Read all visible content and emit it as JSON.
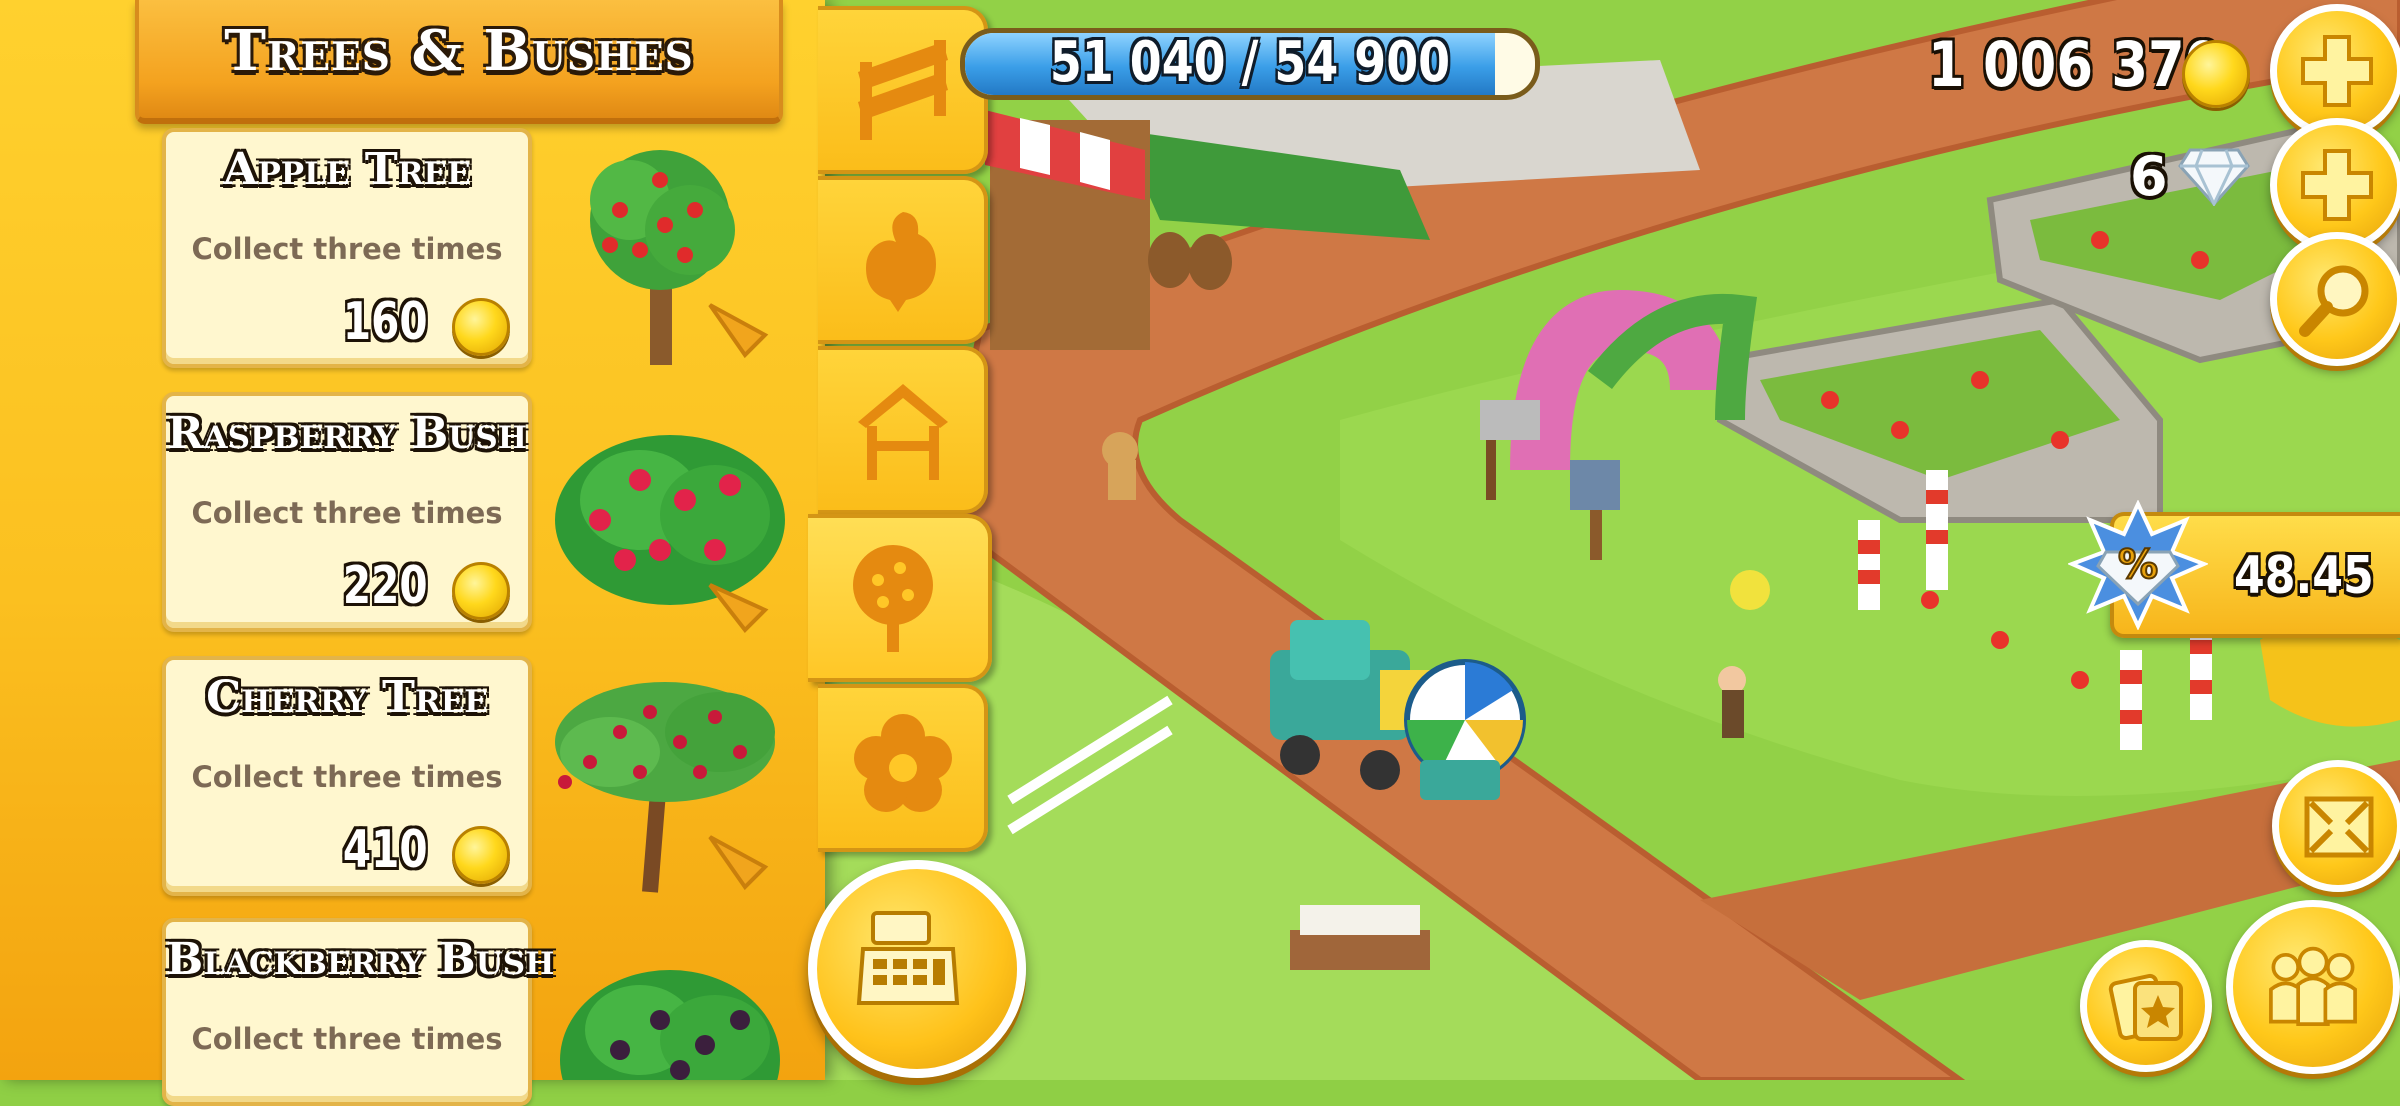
{
  "shop": {
    "title": "Trees & Bushes",
    "items": [
      {
        "name": "Apple Tree",
        "description": "Collect three times",
        "price": "160"
      },
      {
        "name": "Raspberry Bush",
        "description": "Collect three times",
        "price": "220"
      },
      {
        "name": "Cherry Tree",
        "description": "Collect three times",
        "price": "410"
      },
      {
        "name": "Blackberry Bush",
        "description": "Collect three times",
        "price": ""
      }
    ],
    "categories": [
      {
        "icon": "fence-icon",
        "active": false
      },
      {
        "icon": "chicken-icon",
        "active": false
      },
      {
        "icon": "shed-icon",
        "active": false
      },
      {
        "icon": "tree-icon",
        "active": true
      },
      {
        "icon": "flower-icon",
        "active": false
      }
    ]
  },
  "hud": {
    "xp_text": "51 040 / 54 900",
    "xp_current": 51040,
    "xp_max": 54900,
    "coins": "1 006 370",
    "diamonds": "6",
    "sale_timer": "48.45"
  },
  "colors": {
    "panel": "#fbc020",
    "card": "#fff7cf",
    "xp_fill": "#3a9ee8",
    "coin": "#ffd81c",
    "road": "#c8693c",
    "grass": "#8fcf45"
  }
}
